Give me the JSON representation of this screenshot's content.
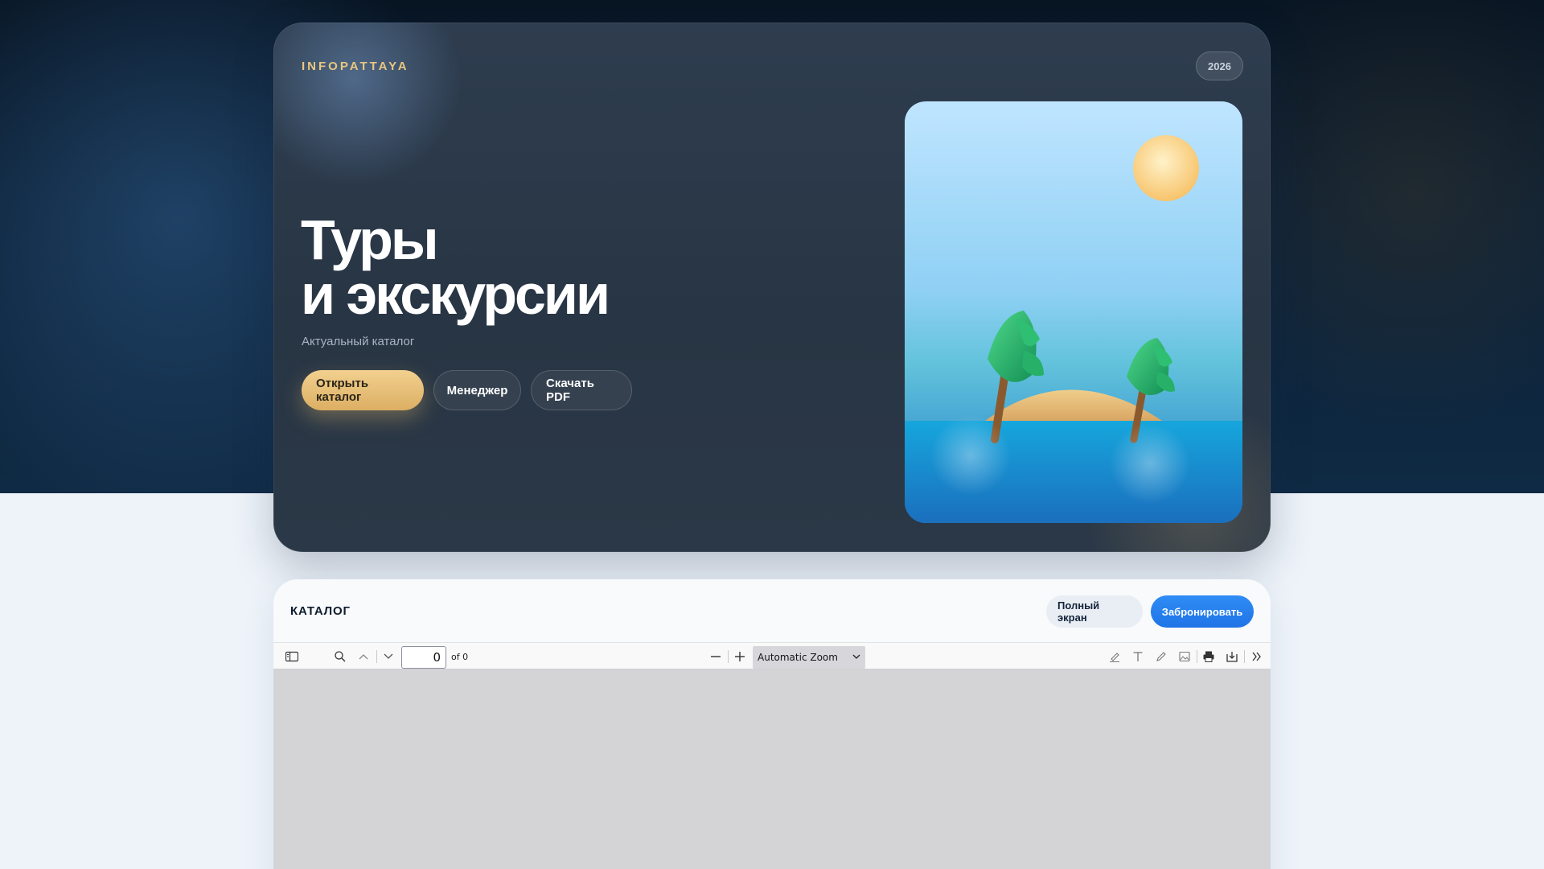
{
  "hero": {
    "brand": "INFOPATTAYA",
    "year": "2026",
    "title_line1": "Туры",
    "title_line2": "и экскурсии",
    "subtitle": "Актуальный каталог",
    "buttons": {
      "open_catalog": "Открыть каталог",
      "manager": "Менеджер",
      "download_pdf": "Скачать PDF"
    }
  },
  "catalog": {
    "title": "КАТАЛОГ",
    "fullscreen_label": "Полный экран",
    "book_label": "Забронировать"
  },
  "pdf_viewer": {
    "page_number": "0",
    "page_count_text": "of 0",
    "zoom_label": "Automatic Zoom",
    "icons": [
      "sidebar-toggle-icon",
      "search-icon",
      "previous-page-icon",
      "next-page-icon",
      "zoom-out-icon",
      "zoom-in-icon",
      "highlight-icon",
      "text-icon",
      "draw-icon",
      "image-icon",
      "print-icon",
      "save-icon",
      "tools-icon"
    ]
  },
  "colors": {
    "brand_gold": "#e8c77e",
    "primary_blue": "#1f74e6",
    "hero_bg": "#283544"
  }
}
